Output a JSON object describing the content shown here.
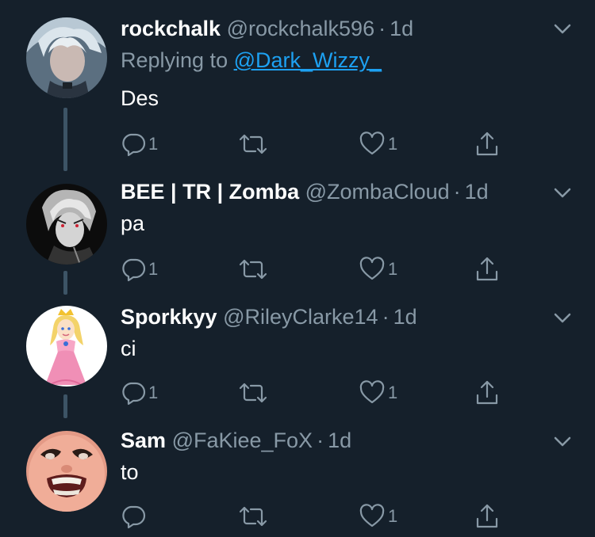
{
  "tweets": [
    {
      "display_name": "rockchalk",
      "handle": "@rockchalk596",
      "separator": "·",
      "time": "1d",
      "replying_prefix": "Replying to ",
      "replying_to": "@Dark_Wizzy_",
      "text": "Des",
      "reply_count": "1",
      "retweet_count": "",
      "like_count": "1",
      "avatar": "silver-haired-anime-character"
    },
    {
      "display_name": "BEE | TR | Zomba",
      "handle": "@ZombaCloud",
      "separator": "·",
      "time": "1d",
      "text": "pa",
      "reply_count": "1",
      "retweet_count": "",
      "like_count": "1",
      "avatar": "monochrome-anime-character"
    },
    {
      "display_name": "Sporkkyy",
      "handle": "@RileyClarke14",
      "separator": "·",
      "time": "1d",
      "text": "ci",
      "reply_count": "1",
      "retweet_count": "",
      "like_count": "1",
      "avatar": "princess-peach"
    },
    {
      "display_name": "Sam",
      "handle": "@FaKiee_FoX",
      "separator": "·",
      "time": "1d",
      "text": "to",
      "reply_count": "",
      "retweet_count": "",
      "like_count": "1",
      "avatar": "distorted-face"
    }
  ],
  "icons": {
    "reply": "reply-icon",
    "retweet": "retweet-icon",
    "like": "heart-icon",
    "share": "share-icon",
    "menu": "chevron-down-icon"
  },
  "colors": {
    "background": "#15202b",
    "secondary_text": "#8899a6",
    "link": "#1da1f2",
    "thread_line": "#3d5466"
  }
}
